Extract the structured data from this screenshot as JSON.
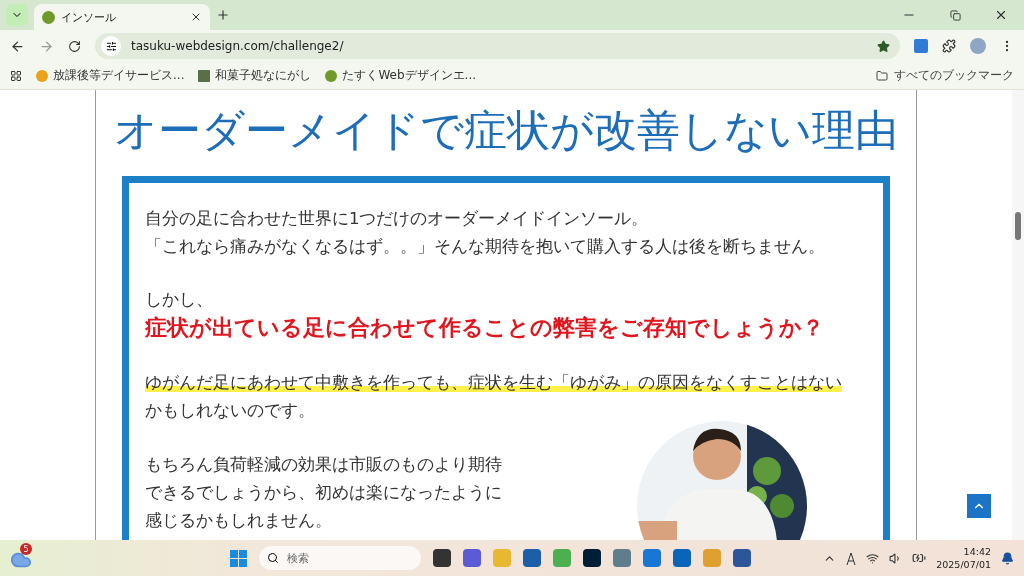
{
  "tabs": [
    {
      "title": "インソール",
      "selected": true
    }
  ],
  "address": {
    "url": "tasuku-webdesign.com/challenge2/",
    "bookmarked": true
  },
  "bookmarks": [
    {
      "label": "放課後等デイサービス..."
    },
    {
      "label": "和菓子処なにがし"
    },
    {
      "label": "たすくWebデザインエ..."
    }
  ],
  "all_bookmarks": "すべてのブックマーク",
  "page": {
    "heading": "オーダーメイドで症状が改善しない理由",
    "intro_lines": [
      "自分の足に合わせた世界に1つだけのオーダーメイドインソール。",
      "「これなら痛みがなくなるはず。。」そんな期待を抱いて購入する人は後を断ちません。"
    ],
    "lead": "しかし、",
    "question": "症状が出ている足に合わせて作ることの弊害をご存知でしょうか？",
    "highlighted": "ゆがんだ足にあわせて中敷きを作っても、症状を生む「ゆがみ」の原因をなくすことはない",
    "highlighted_rest": "かもしれないのです。",
    "closing_lines": [
      "もちろん負荷軽減の効果は市販のものより期待",
      "できるでしょうから、初めは楽になったように",
      "感じるかもしれません。"
    ]
  },
  "taskbar": {
    "weather_badge": "5",
    "search_placeholder": "検索",
    "time": "14:42",
    "date": "2025/07/01"
  }
}
